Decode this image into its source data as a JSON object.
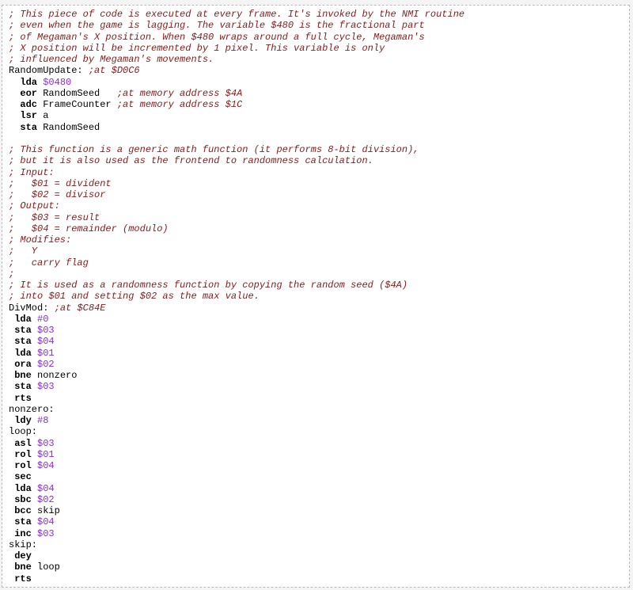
{
  "lines": [
    {
      "t": "c",
      "text": "; This piece of code is executed at every frame. It's invoked by the NMI routine"
    },
    {
      "t": "c",
      "text": "; even when the game is lagging. The variable $480 is the fractional part"
    },
    {
      "t": "c",
      "text": "; of Megaman's X position. When $480 wraps around a full cycle, Megaman's"
    },
    {
      "t": "c",
      "text": "; X position will be incremented by 1 pixel. This variable is only"
    },
    {
      "t": "c",
      "text": "; influenced by Megaman's movements."
    },
    {
      "t": "lbl",
      "label": "RandomUpdate:",
      "comment": " ;at $D0C6"
    },
    {
      "t": "i",
      "indent": "  ",
      "op": "lda",
      "sp": " ",
      "arg": "$0480",
      "argType": "num",
      "comment": ""
    },
    {
      "t": "i",
      "indent": "  ",
      "op": "eor",
      "sp": " ",
      "arg": "RandomSeed",
      "argType": "ident",
      "comment": "   ;at memory address $4A"
    },
    {
      "t": "i",
      "indent": "  ",
      "op": "adc",
      "sp": " ",
      "arg": "FrameCounter",
      "argType": "ident",
      "comment": " ;at memory address $1C"
    },
    {
      "t": "i",
      "indent": "  ",
      "op": "lsr",
      "sp": " ",
      "arg": "a",
      "argType": "ident",
      "comment": ""
    },
    {
      "t": "i",
      "indent": "  ",
      "op": "sta",
      "sp": " ",
      "arg": "RandomSeed",
      "argType": "ident",
      "comment": ""
    },
    {
      "t": "blank"
    },
    {
      "t": "c",
      "text": "; This function is a generic math function (it performs 8-bit division),"
    },
    {
      "t": "c",
      "text": "; but it is also used as the frontend to randomness calculation."
    },
    {
      "t": "c",
      "text": "; Input:"
    },
    {
      "t": "c",
      "text": ";   $01 = divident"
    },
    {
      "t": "c",
      "text": ";   $02 = divisor"
    },
    {
      "t": "c",
      "text": "; Output:"
    },
    {
      "t": "c",
      "text": ";   $03 = result"
    },
    {
      "t": "c",
      "text": ";   $04 = remainder (modulo)"
    },
    {
      "t": "c",
      "text": "; Modifies:"
    },
    {
      "t": "c",
      "text": ";   Y"
    },
    {
      "t": "c",
      "text": ";   carry flag"
    },
    {
      "t": "c",
      "text": ";"
    },
    {
      "t": "c",
      "text": "; It is used as a randomness function by copying the random seed ($4A)"
    },
    {
      "t": "c",
      "text": "; into $01 and setting $02 as the max value."
    },
    {
      "t": "lbl",
      "label": "DivMod:",
      "comment": " ;at $C84E"
    },
    {
      "t": "i",
      "indent": " ",
      "op": "lda",
      "sp": " ",
      "arg": "#0",
      "argType": "num",
      "comment": ""
    },
    {
      "t": "i",
      "indent": " ",
      "op": "sta",
      "sp": " ",
      "arg": "$03",
      "argType": "num",
      "comment": ""
    },
    {
      "t": "i",
      "indent": " ",
      "op": "sta",
      "sp": " ",
      "arg": "$04",
      "argType": "num",
      "comment": ""
    },
    {
      "t": "i",
      "indent": " ",
      "op": "lda",
      "sp": " ",
      "arg": "$01",
      "argType": "num",
      "comment": ""
    },
    {
      "t": "i",
      "indent": " ",
      "op": "ora",
      "sp": " ",
      "arg": "$02",
      "argType": "num",
      "comment": ""
    },
    {
      "t": "i",
      "indent": " ",
      "op": "bne",
      "sp": " ",
      "arg": "nonzero",
      "argType": "ident",
      "comment": ""
    },
    {
      "t": "i",
      "indent": " ",
      "op": "sta",
      "sp": " ",
      "arg": "$03",
      "argType": "num",
      "comment": ""
    },
    {
      "t": "i",
      "indent": " ",
      "op": "rts",
      "sp": "",
      "arg": "",
      "argType": "ident",
      "comment": ""
    },
    {
      "t": "lbl",
      "label": "nonzero:",
      "comment": ""
    },
    {
      "t": "i",
      "indent": " ",
      "op": "ldy",
      "sp": " ",
      "arg": "#8",
      "argType": "num",
      "comment": ""
    },
    {
      "t": "lbl",
      "label": "loop:",
      "comment": ""
    },
    {
      "t": "i",
      "indent": " ",
      "op": "asl",
      "sp": " ",
      "arg": "$03",
      "argType": "num",
      "comment": ""
    },
    {
      "t": "i",
      "indent": " ",
      "op": "rol",
      "sp": " ",
      "arg": "$01",
      "argType": "num",
      "comment": ""
    },
    {
      "t": "i",
      "indent": " ",
      "op": "rol",
      "sp": " ",
      "arg": "$04",
      "argType": "num",
      "comment": ""
    },
    {
      "t": "i",
      "indent": " ",
      "op": "sec",
      "sp": "",
      "arg": "",
      "argType": "ident",
      "comment": ""
    },
    {
      "t": "i",
      "indent": " ",
      "op": "lda",
      "sp": " ",
      "arg": "$04",
      "argType": "num",
      "comment": ""
    },
    {
      "t": "i",
      "indent": " ",
      "op": "sbc",
      "sp": " ",
      "arg": "$02",
      "argType": "num",
      "comment": ""
    },
    {
      "t": "i",
      "indent": " ",
      "op": "bcc",
      "sp": " ",
      "arg": "skip",
      "argType": "ident",
      "comment": ""
    },
    {
      "t": "i",
      "indent": " ",
      "op": "sta",
      "sp": " ",
      "arg": "$04",
      "argType": "num",
      "comment": ""
    },
    {
      "t": "i",
      "indent": " ",
      "op": "inc",
      "sp": " ",
      "arg": "$03",
      "argType": "num",
      "comment": ""
    },
    {
      "t": "lbl",
      "label": "skip:",
      "comment": ""
    },
    {
      "t": "i",
      "indent": " ",
      "op": "dey",
      "sp": "",
      "arg": "",
      "argType": "ident",
      "comment": ""
    },
    {
      "t": "i",
      "indent": " ",
      "op": "bne",
      "sp": " ",
      "arg": "loop",
      "argType": "ident",
      "comment": ""
    },
    {
      "t": "i",
      "indent": " ",
      "op": "rts",
      "sp": "",
      "arg": "",
      "argType": "ident",
      "comment": ""
    }
  ],
  "colors": {
    "comment": "#8b1a1a",
    "number": "#8a2be2",
    "text": "#1a1a1a",
    "frame_border": "#b9b9b9",
    "background": "#f4f4f4"
  }
}
